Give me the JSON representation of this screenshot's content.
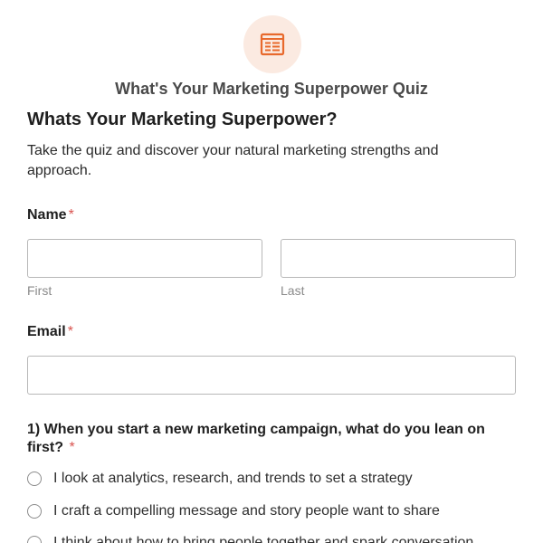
{
  "header": {
    "icon": "form-document-icon",
    "accent_color": "#e8692c",
    "form_title": "What's Your Marketing Superpower Quiz"
  },
  "intro": {
    "heading": "Whats Your Marketing Superpower?",
    "description": "Take the quiz and discover your natural marketing strengths and approach."
  },
  "name_field": {
    "label": "Name",
    "required_mark": "*",
    "first_value": "",
    "last_value": "",
    "first_sublabel": "First",
    "last_sublabel": "Last"
  },
  "email_field": {
    "label": "Email",
    "required_mark": "*",
    "value": ""
  },
  "question1": {
    "text": "1) When you start a new marketing campaign, what do you lean on first?",
    "required_mark": "*",
    "options": [
      "I look at analytics, research, and trends to set a strategy",
      "I craft a compelling message and story people want to share",
      "I think about how to bring people together and spark conversation"
    ]
  }
}
